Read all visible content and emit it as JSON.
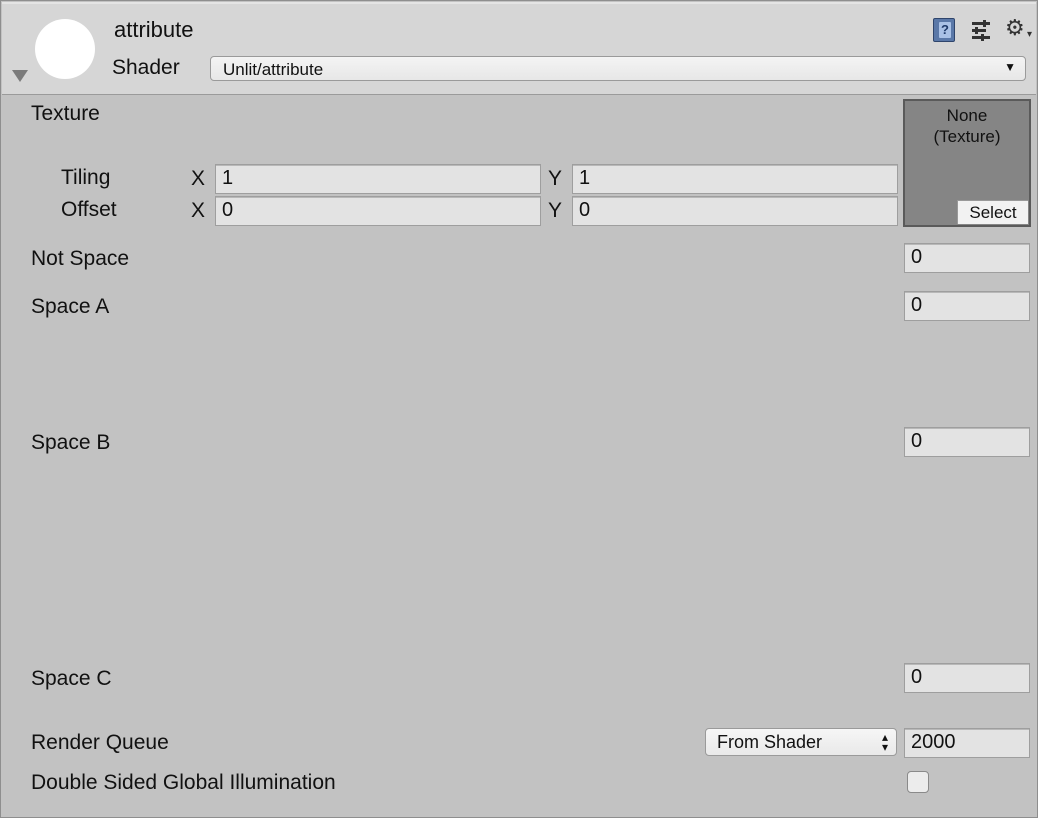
{
  "header": {
    "title": "attribute",
    "shader_label": "Shader",
    "shader_value": "Unlit/attribute",
    "icons": [
      "help-book-icon",
      "preset-sliders-icon",
      "gear-icon"
    ]
  },
  "texture": {
    "label": "Texture",
    "tiling_label": "Tiling",
    "offset_label": "Offset",
    "x_label": "X",
    "y_label": "Y",
    "tiling_x": "1",
    "tiling_y": "1",
    "offset_x": "0",
    "offset_y": "0",
    "slot_text_line1": "None",
    "slot_text_line2": "(Texture)",
    "select_label": "Select"
  },
  "properties": {
    "not_space": {
      "label": "Not Space",
      "value": "0"
    },
    "space_a": {
      "label": "Space A",
      "value": "0"
    },
    "space_b": {
      "label": "Space B",
      "value": "0"
    },
    "space_c": {
      "label": "Space C",
      "value": "0"
    }
  },
  "render_queue": {
    "label": "Render Queue",
    "mode": "From Shader",
    "value": "2000"
  },
  "double_sided_gi": {
    "label": "Double Sided Global Illumination",
    "checked": false
  }
}
